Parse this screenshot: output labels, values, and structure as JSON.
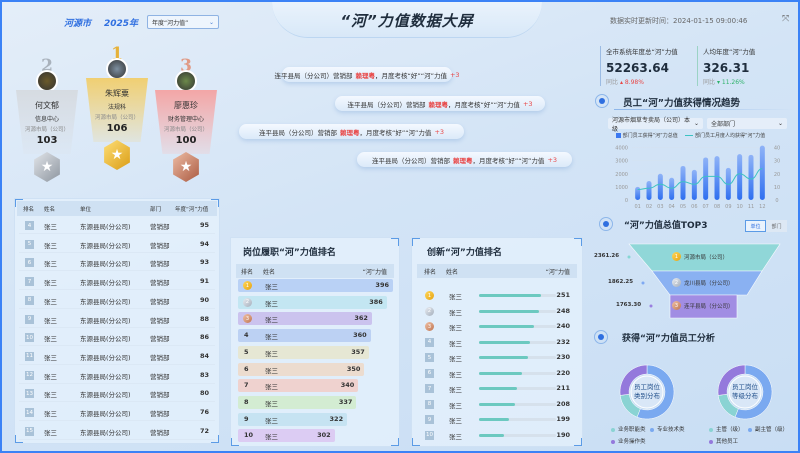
{
  "header": {
    "city": "河源市",
    "year": "2025年",
    "select_value": "年度“河力值”",
    "title": "“河”力值数据大屏",
    "update_time": "数据实时更新时间：2024-01-15 09:00:46",
    "fullscreen_icon": "fullscreen-icon"
  },
  "podium": [
    {
      "rank": "2",
      "name": "何文郁",
      "dept": "信息中心",
      "unit": "河源市局（公司）",
      "value": "103"
    },
    {
      "rank": "1",
      "name": "朱辉粟",
      "dept": "法规科",
      "unit": "河源市局（公司）",
      "value": "106"
    },
    {
      "rank": "3",
      "name": "廖惠珍",
      "dept": "财务管理中心",
      "unit": "河源市局（公司）",
      "value": "100"
    }
  ],
  "ticker": [
    {
      "prefix": "连平县局（分公司）营销部",
      "person": "赖理粤",
      "suffix": "，月度考核“好”“河”力值",
      "delta": "+3"
    },
    {
      "prefix": "连平县局（分公司）营销部",
      "person": "赖理粤",
      "suffix": "，月度考核“好”“河”力值",
      "delta": "+3"
    },
    {
      "prefix": "连平县局（分公司）营销部",
      "person": "赖理粤",
      "suffix": "，月度考核“好”“河”力值",
      "delta": "+3"
    },
    {
      "prefix": "连平县局（分公司）营销部",
      "person": "赖理粤",
      "suffix": "，月度考核“好”“河”力值",
      "delta": "+3"
    }
  ],
  "rank_table": {
    "headers": [
      "排名",
      "姓名",
      "单位",
      "部门",
      "年度“河”力值"
    ],
    "rows": [
      [
        "4",
        "张三",
        "东源县局(分公司)",
        "营销部",
        "95"
      ],
      [
        "5",
        "张三",
        "东源县局(分公司)",
        "营销部",
        "94"
      ],
      [
        "6",
        "张三",
        "东源县局(分公司)",
        "营销部",
        "93"
      ],
      [
        "7",
        "张三",
        "东源县局(分公司)",
        "营销部",
        "91"
      ],
      [
        "8",
        "张三",
        "东源县局(分公司)",
        "营销部",
        "90"
      ],
      [
        "9",
        "张三",
        "东源县局(分公司)",
        "营销部",
        "88"
      ],
      [
        "10",
        "张三",
        "东源县局(分公司)",
        "营销部",
        "86"
      ],
      [
        "11",
        "张三",
        "东源县局(分公司)",
        "营销部",
        "84"
      ],
      [
        "12",
        "张三",
        "东源县局(分公司)",
        "营销部",
        "83"
      ],
      [
        "13",
        "张三",
        "东源县局(分公司)",
        "营销部",
        "80"
      ],
      [
        "14",
        "张三",
        "东源县局(分公司)",
        "营销部",
        "76"
      ],
      [
        "15",
        "张三",
        "东源县局(分公司)",
        "营销部",
        "72"
      ]
    ]
  },
  "post_rank": {
    "title": "岗位履职“河”力值排名",
    "headers": [
      "排名",
      "姓名",
      "“河”力值"
    ],
    "rows": [
      {
        "rank": "1",
        "name": "张三",
        "value": 396,
        "color": "#b9d1f5"
      },
      {
        "rank": "2",
        "name": "张三",
        "value": 386,
        "color": "#c3e6f2"
      },
      {
        "rank": "3",
        "name": "张三",
        "value": 362,
        "color": "#cbc3ee"
      },
      {
        "rank": "4",
        "name": "张三",
        "value": 360,
        "color": "#bcd1f3"
      },
      {
        "rank": "5",
        "name": "张三",
        "value": 357,
        "color": "#e6e7d4"
      },
      {
        "rank": "6",
        "name": "张三",
        "value": 350,
        "color": "#ecdccf"
      },
      {
        "rank": "7",
        "name": "张三",
        "value": 340,
        "color": "#efd2cf"
      },
      {
        "rank": "8",
        "name": "张三",
        "value": 337,
        "color": "#d3ecd2"
      },
      {
        "rank": "9",
        "name": "张三",
        "value": 322,
        "color": "#c6e3f2"
      },
      {
        "rank": "10",
        "name": "张三",
        "value": 302,
        "color": "#dcccf3"
      }
    ]
  },
  "innov_rank": {
    "title": "创新“河”力值排名",
    "headers": [
      "排名",
      "姓名",
      "“河”力值"
    ],
    "rows": [
      {
        "rank": "1",
        "name": "张三",
        "value": 251
      },
      {
        "rank": "2",
        "name": "张三",
        "value": 248
      },
      {
        "rank": "3",
        "name": "张三",
        "value": 240
      },
      {
        "rank": "4",
        "name": "张三",
        "value": 232
      },
      {
        "rank": "5",
        "name": "张三",
        "value": 230
      },
      {
        "rank": "6",
        "name": "张三",
        "value": 220
      },
      {
        "rank": "7",
        "name": "张三",
        "value": 211
      },
      {
        "rank": "8",
        "name": "张三",
        "value": 208
      },
      {
        "rank": "9",
        "name": "张三",
        "value": 199
      },
      {
        "rank": "10",
        "name": "张三",
        "value": 190
      }
    ]
  },
  "stats": [
    {
      "label": "全市系统年度总“河”力值",
      "value": "52263.64",
      "cmp_label": "同比",
      "cmp_value": "8.98%",
      "direction": "up",
      "color": "#e84848"
    },
    {
      "label": "人均年度“河”力值",
      "value": "326.31",
      "cmp_label": "同比",
      "cmp_value": "11.26%",
      "direction": "down",
      "color": "#2fb36b"
    }
  ],
  "trend": {
    "title": "员工“河”力值获得情况趋势",
    "unit_select": "河源市烟草专卖局（公司）本级",
    "dept_select": "全部部门"
  },
  "chart_data": {
    "type": "bar",
    "categories": [
      "01",
      "02",
      "03",
      "04",
      "05",
      "06",
      "07",
      "08",
      "09",
      "10",
      "11",
      "12"
    ],
    "series": [
      {
        "name": "部门员工获得“河”力总值",
        "type": "bar",
        "axis": "left",
        "values": [
          1000,
          1450,
          2000,
          1700,
          2600,
          2300,
          3250,
          3350,
          2450,
          3500,
          3450,
          4150
        ]
      },
      {
        "name": "部门员工月度人均获得“河”力值",
        "type": "line",
        "axis": "right",
        "values": [
          8,
          9,
          12,
          9,
          14,
          12,
          18,
          18,
          12,
          20,
          16,
          24
        ]
      }
    ],
    "y_left": {
      "ticks": [
        "0",
        "1000",
        "2000",
        "3000",
        "4000"
      ],
      "range": [
        0,
        4200
      ]
    },
    "y_right": {
      "ticks": [
        "0",
        "10",
        "20",
        "30",
        "40"
      ],
      "range": [
        0,
        42
      ]
    },
    "legend_position": "top",
    "colors": {
      "bar": "#3b78f0",
      "line": "#3cc3c3"
    }
  },
  "top3": {
    "title": "“河”力值总值TOP3",
    "toggle": [
      "单位",
      "部门"
    ],
    "active_toggle": "单位",
    "items": [
      {
        "rank": "1",
        "name": "河源市局（公司）",
        "value": "2361.26",
        "color": "#86d6d3"
      },
      {
        "rank": "2",
        "name": "龙川县局（分公司）",
        "value": "1862.25",
        "color": "#7fa9f2"
      },
      {
        "rank": "3",
        "name": "连平县局（分公司）",
        "value": "1763.30",
        "color": "#9a7fe0"
      }
    ]
  },
  "analysis": {
    "title": "获得“河”力值员工分析",
    "donuts": [
      {
        "center": "员工岗位类别分布",
        "center_l1": "员工岗位",
        "center_l2": "类别分布",
        "slices": [
          {
            "name": "专业技术类",
            "value": 56,
            "color": "#7aa9f0"
          },
          {
            "name": "业务职能类",
            "value": 17,
            "color": "#8ad3d3"
          },
          {
            "name": "业务操作类",
            "value": 27,
            "color": "#9479dc"
          }
        ],
        "legend": [
          "业务职能类",
          "专业技术类",
          "业务操作类"
        ]
      },
      {
        "center": "员工岗位等级分布",
        "center_l1": "员工岗位",
        "center_l2": "等级分布",
        "slices": [
          {
            "name": "副主管（级）",
            "value": 56,
            "color": "#7aa9f0"
          },
          {
            "name": "主管（级）",
            "value": 17,
            "color": "#8ad3d3"
          },
          {
            "name": "其他员工",
            "value": 27,
            "color": "#9479dc"
          }
        ],
        "legend": [
          "主管（级）",
          "副主管（级）",
          "其他员工"
        ]
      }
    ]
  }
}
